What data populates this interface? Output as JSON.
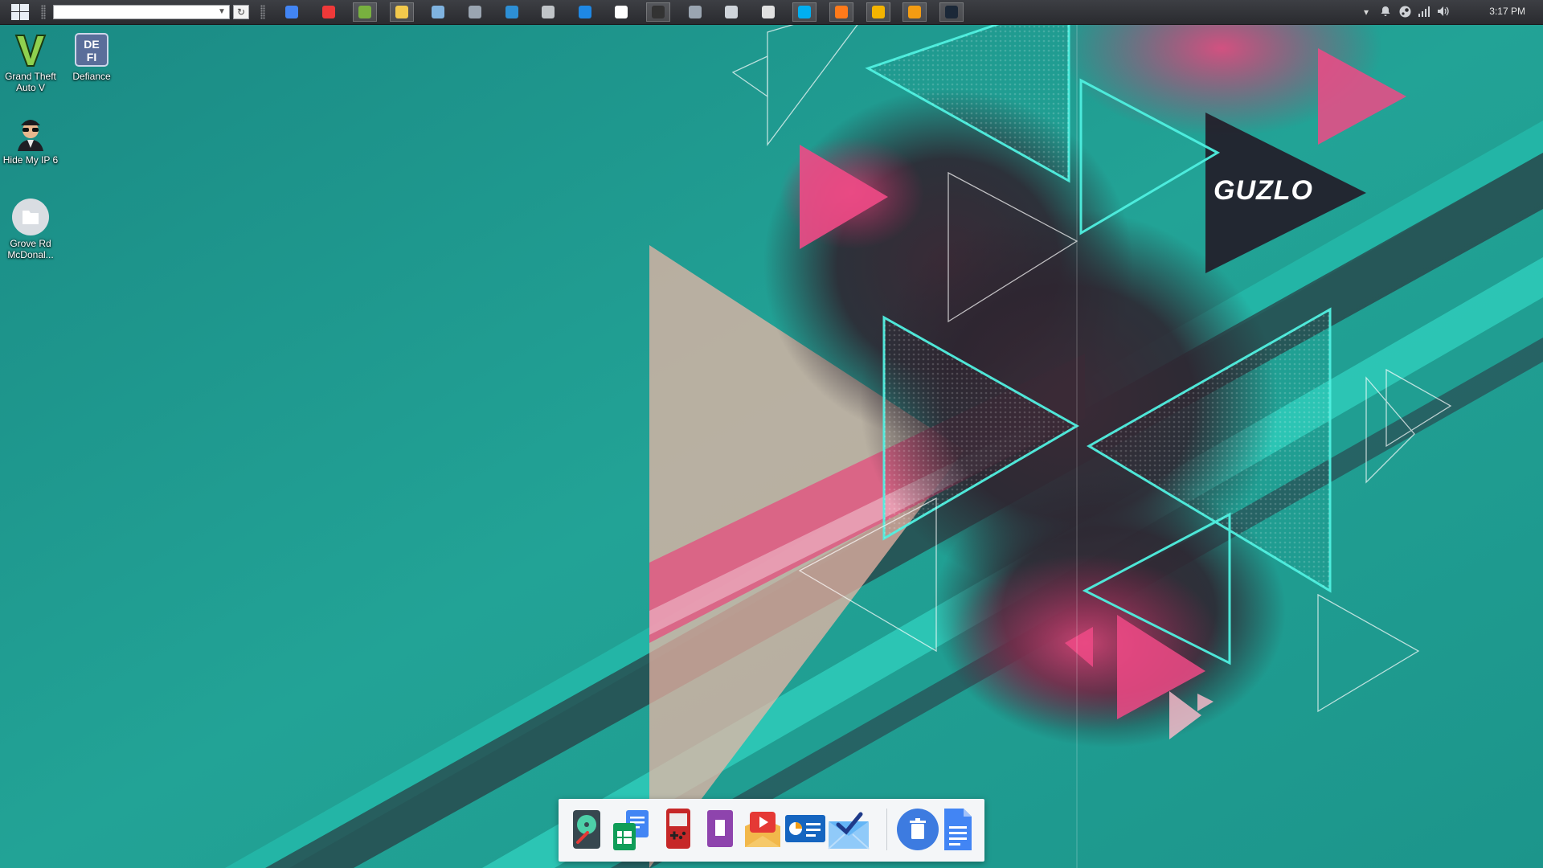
{
  "taskbar": {
    "address_value": "",
    "address_placeholder": "",
    "pinned_apps": [
      {
        "icon": "chrome-icon",
        "color": "#4285f4"
      },
      {
        "icon": "vivaldi-icon",
        "color": "#ef3939"
      },
      {
        "icon": "utorrent-icon",
        "color": "#78b13f",
        "active": true
      },
      {
        "icon": "file-explorer-icon",
        "color": "#f2c94c",
        "active": true
      },
      {
        "icon": "pen-app-icon",
        "color": "#7fb3e0"
      },
      {
        "icon": "image-viewer-icon",
        "color": "#9aa5b1"
      },
      {
        "icon": "settings-app-icon",
        "color": "#2d8fd5"
      },
      {
        "icon": "gamepad-app-icon",
        "color": "#c0c4c8"
      },
      {
        "icon": "teamviewer-icon",
        "color": "#1e88e5"
      },
      {
        "icon": "logitech-g-icon",
        "color": "#ffffff"
      },
      {
        "icon": "terminal-app-icon",
        "color": "#333333",
        "active": true
      },
      {
        "icon": "headphones-app-icon",
        "color": "#9aa5b1"
      },
      {
        "icon": "alienware-icon",
        "color": "#cfd4da"
      },
      {
        "icon": "mail-icon",
        "color": "#e0e0e0"
      },
      {
        "icon": "skype-icon",
        "color": "#00aff0",
        "active": true
      },
      {
        "icon": "burn-app-icon",
        "color": "#ff7a1a",
        "active": true
      },
      {
        "icon": "chrome-canary-icon",
        "color": "#f4b400",
        "active": true
      },
      {
        "icon": "media-player-icon",
        "color": "#f39c12",
        "active": true
      },
      {
        "icon": "steam-icon",
        "color": "#1b2838",
        "active": true
      }
    ],
    "tray_icons": [
      "chevron-up-icon",
      "notification-bell-icon",
      "steam-tray-icon",
      "network-signal-icon",
      "volume-icon"
    ],
    "clock": "3:17 PM"
  },
  "desktop_icons": [
    {
      "name": "gta-v-shortcut",
      "label": "Grand Theft Auto V",
      "icon": "gta-v-logo-icon"
    },
    {
      "name": "defiance-shortcut",
      "label": "Defiance",
      "icon": "defiance-logo-icon"
    },
    {
      "name": "hide-my-ip-shortcut",
      "label": "Hide My IP 6",
      "icon": "spy-man-icon"
    },
    {
      "name": "folder-shortcut",
      "label": "Grove Rd McDonal...",
      "icon": "folder-icon"
    }
  ],
  "wallpaper": {
    "logo_text": "GUZLO",
    "colors": {
      "teal": "#1f9c91",
      "cyan": "#4ff0e0",
      "pink": "#e8467a",
      "peach": "#f2b6a6",
      "dark": "#2a2630"
    }
  },
  "dock": {
    "apps": [
      {
        "icon": "disk-cleaner-icon",
        "color": "#2e7d32"
      },
      {
        "icon": "google-sheets-docs-icon",
        "color": "#0f9d58"
      },
      {
        "icon": "gameboy-icon",
        "color": "#c62828"
      },
      {
        "icon": "video-clip-icon",
        "color": "#8e44ad"
      },
      {
        "icon": "youtube-player-icon",
        "color": "#f2b84b"
      },
      {
        "icon": "slides-presentation-icon",
        "color": "#1565c0"
      },
      {
        "icon": "inbox-mail-icon",
        "color": "#1e88e5"
      },
      {
        "icon": "trash-icon",
        "color": "#3d7be0"
      },
      {
        "icon": "google-docs-icon",
        "color": "#4285f4"
      }
    ]
  }
}
